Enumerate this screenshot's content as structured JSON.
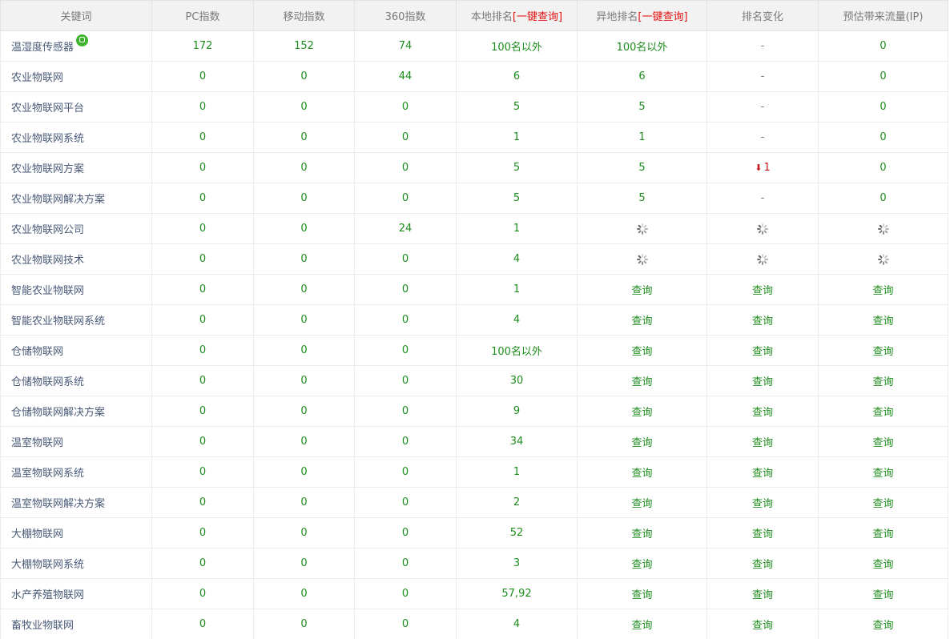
{
  "headers": {
    "keyword": "关键词",
    "pc": "PC指数",
    "mobile": "移动指数",
    "s360": "360指数",
    "local_prefix": "本地排名",
    "local_link": "[一键查询]",
    "remote_prefix": "异地排名",
    "remote_link": "[一键查询]",
    "change": "排名变化",
    "traffic": "预估带来流量(IP)"
  },
  "rows": [
    {
      "keyword": "温湿度传感器",
      "badge": "green-badge-icon",
      "pc": "172",
      "mobile": "152",
      "s360": "74",
      "local": "100名以外",
      "remote": "100名以外",
      "change": "-",
      "change_type": "dash",
      "traffic": "0"
    },
    {
      "keyword": "农业物联网",
      "pc": "0",
      "mobile": "0",
      "s360": "44",
      "local": "6",
      "remote": "6",
      "change": "-",
      "change_type": "dash",
      "traffic": "0"
    },
    {
      "keyword": "农业物联网平台",
      "pc": "0",
      "mobile": "0",
      "s360": "0",
      "local": "5",
      "remote": "5",
      "change": "-",
      "change_type": "dash",
      "traffic": "0"
    },
    {
      "keyword": "农业物联网系统",
      "pc": "0",
      "mobile": "0",
      "s360": "0",
      "local": "1",
      "remote": "1",
      "change": "-",
      "change_type": "dash",
      "traffic": "0"
    },
    {
      "keyword": "农业物联网方案",
      "pc": "0",
      "mobile": "0",
      "s360": "0",
      "local": "5",
      "remote": "5",
      "change": "1",
      "change_type": "down",
      "traffic": "0"
    },
    {
      "keyword": "农业物联网解决方案",
      "pc": "0",
      "mobile": "0",
      "s360": "0",
      "local": "5",
      "remote": "5",
      "change": "-",
      "change_type": "dash",
      "traffic": "0"
    },
    {
      "keyword": "农业物联网公司",
      "pc": "0",
      "mobile": "0",
      "s360": "24",
      "local": "1",
      "remote": null,
      "remote_type": "loading",
      "change": null,
      "change_type": "loading",
      "traffic": null,
      "traffic_type": "loading"
    },
    {
      "keyword": "农业物联网技术",
      "pc": "0",
      "mobile": "0",
      "s360": "0",
      "local": "4",
      "remote": null,
      "remote_type": "loading",
      "change": null,
      "change_type": "loading",
      "traffic": null,
      "traffic_type": "loading"
    },
    {
      "keyword": "智能农业物联网",
      "pc": "0",
      "mobile": "0",
      "s360": "0",
      "local": "1",
      "remote": "查询",
      "remote_type": "query",
      "change": "查询",
      "change_type": "query",
      "traffic": "查询",
      "traffic_type": "query"
    },
    {
      "keyword": "智能农业物联网系统",
      "pc": "0",
      "mobile": "0",
      "s360": "0",
      "local": "4",
      "remote": "查询",
      "remote_type": "query",
      "change": "查询",
      "change_type": "query",
      "traffic": "查询",
      "traffic_type": "query"
    },
    {
      "keyword": "仓储物联网",
      "pc": "0",
      "mobile": "0",
      "s360": "0",
      "local": "100名以外",
      "remote": "查询",
      "remote_type": "query",
      "change": "查询",
      "change_type": "query",
      "traffic": "查询",
      "traffic_type": "query"
    },
    {
      "keyword": "仓储物联网系统",
      "pc": "0",
      "mobile": "0",
      "s360": "0",
      "local": "30",
      "remote": "查询",
      "remote_type": "query",
      "change": "查询",
      "change_type": "query",
      "traffic": "查询",
      "traffic_type": "query"
    },
    {
      "keyword": "仓储物联网解决方案",
      "pc": "0",
      "mobile": "0",
      "s360": "0",
      "local": "9",
      "remote": "查询",
      "remote_type": "query",
      "change": "查询",
      "change_type": "query",
      "traffic": "查询",
      "traffic_type": "query"
    },
    {
      "keyword": "温室物联网",
      "pc": "0",
      "mobile": "0",
      "s360": "0",
      "local": "34",
      "remote": "查询",
      "remote_type": "query",
      "change": "查询",
      "change_type": "query",
      "traffic": "查询",
      "traffic_type": "query"
    },
    {
      "keyword": "温室物联网系统",
      "pc": "0",
      "mobile": "0",
      "s360": "0",
      "local": "1",
      "remote": "查询",
      "remote_type": "query",
      "change": "查询",
      "change_type": "query",
      "traffic": "查询",
      "traffic_type": "query"
    },
    {
      "keyword": "温室物联网解决方案",
      "pc": "0",
      "mobile": "0",
      "s360": "0",
      "local": "2",
      "remote": "查询",
      "remote_type": "query",
      "change": "查询",
      "change_type": "query",
      "traffic": "查询",
      "traffic_type": "query"
    },
    {
      "keyword": "大棚物联网",
      "pc": "0",
      "mobile": "0",
      "s360": "0",
      "local": "52",
      "remote": "查询",
      "remote_type": "query",
      "change": "查询",
      "change_type": "query",
      "traffic": "查询",
      "traffic_type": "query"
    },
    {
      "keyword": "大棚物联网系统",
      "pc": "0",
      "mobile": "0",
      "s360": "0",
      "local": "3",
      "remote": "查询",
      "remote_type": "query",
      "change": "查询",
      "change_type": "query",
      "traffic": "查询",
      "traffic_type": "query"
    },
    {
      "keyword": "水产养殖物联网",
      "pc": "0",
      "mobile": "0",
      "s360": "0",
      "local": "57,92",
      "remote": "查询",
      "remote_type": "query",
      "change": "查询",
      "change_type": "query",
      "traffic": "查询",
      "traffic_type": "query"
    },
    {
      "keyword": "畜牧业物联网",
      "pc": "0",
      "mobile": "0",
      "s360": "0",
      "local": "4",
      "remote": "查询",
      "remote_type": "query",
      "change": "查询",
      "change_type": "query",
      "traffic": "查询",
      "traffic_type": "query"
    }
  ],
  "colors": {
    "value_green": "#1d8d1d",
    "keyword_text": "#4a5a78",
    "header_bg": "#f2f2f2",
    "header_text": "#7a7a7a",
    "link_red": "#e41010",
    "down_red": "#c2181d"
  }
}
